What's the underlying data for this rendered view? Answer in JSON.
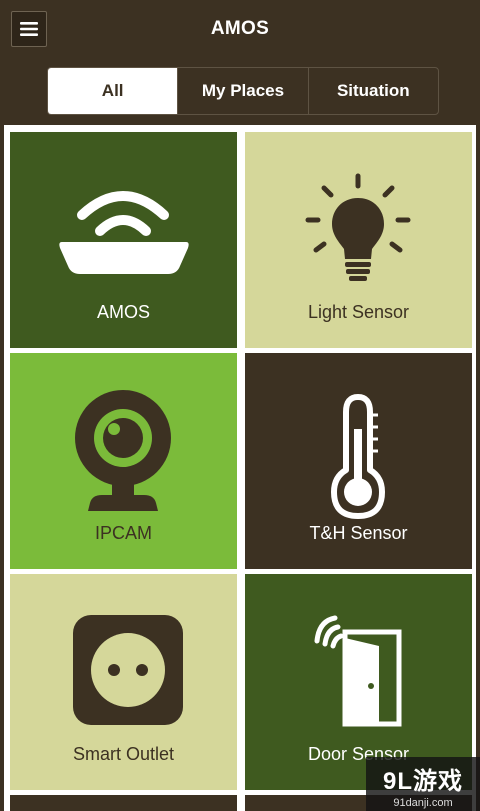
{
  "header": {
    "title": "AMOS",
    "menu_icon": "hamburger-menu-icon"
  },
  "tabs": [
    {
      "label": "All",
      "active": true
    },
    {
      "label": "My Places",
      "active": false
    },
    {
      "label": "Situation",
      "active": false
    }
  ],
  "devices": [
    {
      "label": "AMOS",
      "icon": "router-wifi-icon",
      "bg": "#3f5a1f",
      "fg": "#ffffff"
    },
    {
      "label": "Light Sensor",
      "icon": "light-bulb-icon",
      "bg": "#d5d79a",
      "fg": "#3c3122"
    },
    {
      "label": "IPCAM",
      "icon": "webcam-icon",
      "bg": "#7bbb3a",
      "fg": "#3c3122"
    },
    {
      "label": "T&H Sensor",
      "icon": "thermometer-icon",
      "bg": "#3c3122",
      "fg": "#ffffff"
    },
    {
      "label": "Smart Outlet",
      "icon": "power-outlet-icon",
      "bg": "#d5d79a",
      "fg": "#3c3122"
    },
    {
      "label": "Door Sensor",
      "icon": "door-sensor-icon",
      "bg": "#3f5a1f",
      "fg": "#ffffff"
    }
  ],
  "watermark": {
    "logo": "9L游戏",
    "url": "91danji.com"
  },
  "colors": {
    "header_bg": "#3c3122",
    "dark_green": "#3f5a1f",
    "light_green": "#7bbb3a",
    "pale_yellow": "#d5d79a",
    "dark_brown": "#3c3122"
  }
}
